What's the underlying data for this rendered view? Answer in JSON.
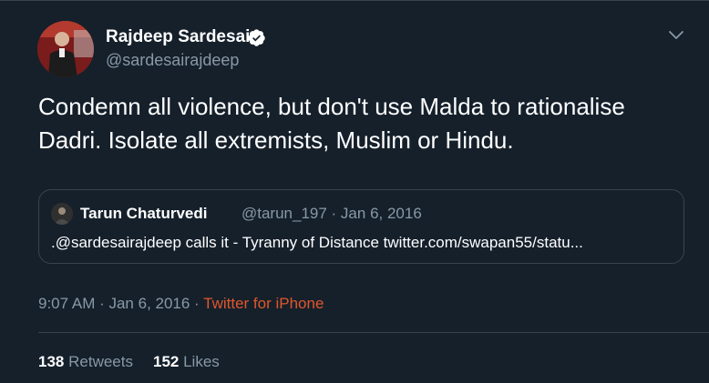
{
  "author": {
    "name": "Rajdeep Sardesai",
    "handle": "@sardesairajdeep",
    "verified": true
  },
  "tweet": {
    "text": "Condemn all violence, but don't use Malda to rationalise Dadri. Isolate all extremists, Muslim or Hindu."
  },
  "quote": {
    "name": "Tarun Chaturvedi",
    "meta": "@tarun_197 · Jan 6, 2016",
    "text": ".@sardesairajdeep calls it - Tyranny of Distance twitter.com/swapan55/statu..."
  },
  "timestamp": {
    "time_date": "9:07 AM · Jan 6, 2016 · ",
    "source": "Twitter for iPhone"
  },
  "stats": {
    "retweets_count": "138",
    "retweets_label": "Retweets",
    "likes_count": "152",
    "likes_label": "Likes"
  },
  "colors": {
    "background": "#15202b",
    "border": "#38444d",
    "secondary_text": "#8899a6",
    "source_link": "#e0562b",
    "verified_badge": "#ffffff"
  },
  "icons": {
    "verified": "verified-badge-icon",
    "menu": "chevron-down-icon"
  }
}
